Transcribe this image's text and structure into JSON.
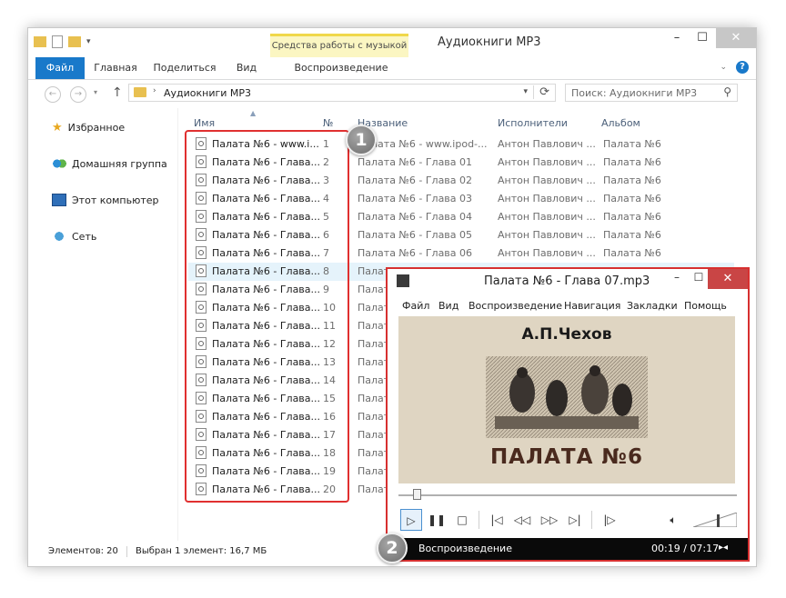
{
  "window": {
    "title": "Аудиокниги MP3",
    "contextual_tab_group": "Средства работы с музыкой"
  },
  "ribbon": {
    "tabs": [
      "Файл",
      "Главная",
      "Поделиться",
      "Вид",
      "Воспроизведение"
    ]
  },
  "address": {
    "path": "Аудиокниги MP3",
    "search_placeholder": "Поиск: Аудиокниги MP3"
  },
  "nav_pane": {
    "items": [
      "Избранное",
      "Домашняя группа",
      "Этот компьютер",
      "Сеть"
    ]
  },
  "columns": [
    "Имя",
    "№",
    "Название",
    "Исполнители",
    "Альбом"
  ],
  "rows": [
    {
      "name": "Палата №6 - www.i...",
      "num": "1",
      "title": "Палата №6 - www.ipod-...",
      "artist": "Антон Павлович ...",
      "album": "Палата №6"
    },
    {
      "name": "Палата №6 - Глава...",
      "num": "2",
      "title": "Палата №6 - Глава 01",
      "artist": "Антон Павлович ...",
      "album": "Палата №6"
    },
    {
      "name": "Палата №6 - Глава...",
      "num": "3",
      "title": "Палата №6 - Глава 02",
      "artist": "Антон Павлович ...",
      "album": "Палата №6"
    },
    {
      "name": "Палата №6 - Глава...",
      "num": "4",
      "title": "Палата №6 - Глава 03",
      "artist": "Антон Павлович ...",
      "album": "Палата №6"
    },
    {
      "name": "Палата №6 - Глава...",
      "num": "5",
      "title": "Палата №6 - Глава 04",
      "artist": "Антон Павлович ...",
      "album": "Палата №6"
    },
    {
      "name": "Палата №6 - Глава...",
      "num": "6",
      "title": "Палата №6 - Глава 05",
      "artist": "Антон Павлович ...",
      "album": "Палата №6"
    },
    {
      "name": "Палата №6 - Глава...",
      "num": "7",
      "title": "Палата №6 - Глава 06",
      "artist": "Антон Павлович ...",
      "album": "Палата №6"
    },
    {
      "name": "Палата №6 - Глава...",
      "num": "8",
      "title": "Палат",
      "artist": "",
      "album": ""
    },
    {
      "name": "Палата №6 - Глава...",
      "num": "9",
      "title": "Палат",
      "artist": "",
      "album": ""
    },
    {
      "name": "Палата №6 - Глава...",
      "num": "10",
      "title": "Палат",
      "artist": "",
      "album": ""
    },
    {
      "name": "Палата №6 - Глава...",
      "num": "11",
      "title": "Палат",
      "artist": "",
      "album": ""
    },
    {
      "name": "Палата №6 - Глава...",
      "num": "12",
      "title": "Палат",
      "artist": "",
      "album": ""
    },
    {
      "name": "Палата №6 - Глава...",
      "num": "13",
      "title": "Палат",
      "artist": "",
      "album": ""
    },
    {
      "name": "Палата №6 - Глава...",
      "num": "14",
      "title": "Палат",
      "artist": "",
      "album": ""
    },
    {
      "name": "Палата №6 - Глава...",
      "num": "15",
      "title": "Палат",
      "artist": "",
      "album": ""
    },
    {
      "name": "Палата №6 - Глава...",
      "num": "16",
      "title": "Палат",
      "artist": "",
      "album": ""
    },
    {
      "name": "Палата №6 - Глава...",
      "num": "17",
      "title": "Палат",
      "artist": "",
      "album": ""
    },
    {
      "name": "Палата №6 - Глава...",
      "num": "18",
      "title": "Палат",
      "artist": "",
      "album": ""
    },
    {
      "name": "Палата №6 - Глава...",
      "num": "19",
      "title": "Палат",
      "artist": "",
      "album": ""
    },
    {
      "name": "Палата №6 - Глава...",
      "num": "20",
      "title": "Палат",
      "artist": "",
      "album": ""
    }
  ],
  "selected_row": 8,
  "status": {
    "count": "Элементов: 20",
    "selection": "Выбран 1 элемент: 16,7 МБ"
  },
  "callouts": [
    "1",
    "2"
  ],
  "player": {
    "title": "Палата №6 - Глава 07.mp3",
    "menu": [
      "Файл",
      "Вид",
      "Воспроизведение",
      "Навигация",
      "Закладки",
      "Помощь"
    ],
    "cover_author": "А.П.Чехов",
    "cover_title": "ПАЛАТА №6",
    "status_text": "Воспроизведение",
    "time": "00:19 / 07:17",
    "progress": 0.043
  },
  "colors": {
    "accent": "#1979ca",
    "highlight": "#e03030",
    "selected_row": "#e5f3fb",
    "ribbon_context": "#fbf6c2"
  }
}
